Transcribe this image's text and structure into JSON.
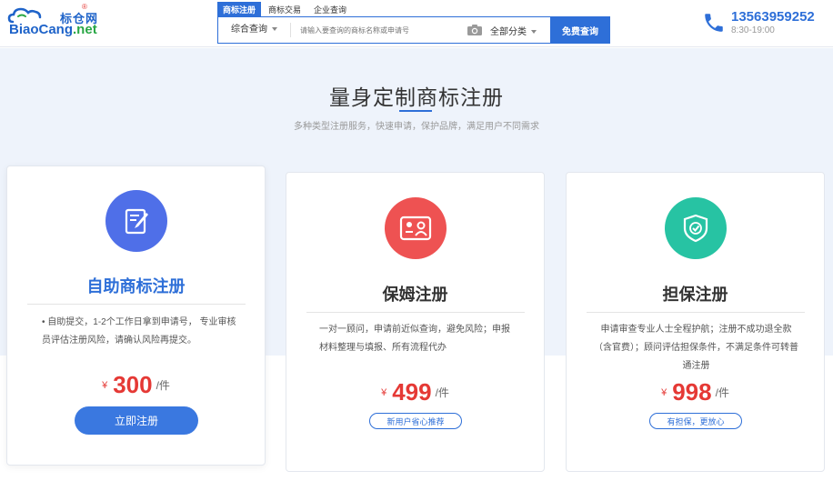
{
  "header": {
    "logo_cn": "标仓网",
    "logo_reg": "®",
    "logo_en_a": "BiaoCang",
    "logo_en_b": ".net",
    "search_tabs": [
      {
        "label": "商标注册",
        "active": true
      },
      {
        "label": "商标交易",
        "active": false
      },
      {
        "label": "企业查询",
        "active": false
      }
    ],
    "search_type": "综合查询",
    "search_placeholder": "请输入要查询的商标名称或申请号",
    "category": "全部分类",
    "search_button": "免费查询",
    "phone": "13563959252",
    "hours": "8:30-19:00"
  },
  "section": {
    "title": "量身定制商标注册",
    "subtitle": "多种类型注册服务，快速申请，保护品牌，满足用户不同需求"
  },
  "cards": [
    {
      "icon": "edit-document-icon",
      "title": "自助商标注册",
      "desc": "• 自助提交，1-2个工作日拿到申请号， 专业审核员评估注册风险，请确认风险再提交。",
      "currency": "¥",
      "price": "300",
      "unit": "/件",
      "cta": "立即注册"
    },
    {
      "icon": "id-card-icon",
      "title": "保姆注册",
      "desc": "一对一顾问，申请前近似查询，避免风险；申报材料整理与填报、所有流程代办",
      "currency": "¥",
      "price": "499",
      "unit": "/件",
      "tag": "新用户省心推荐"
    },
    {
      "icon": "shield-check-icon",
      "title": "担保注册",
      "desc": "申请审查专业人士全程护航；注册不成功退全款（含官费）；顾问评估担保条件，不满足条件可转普通注册",
      "currency": "¥",
      "price": "998",
      "unit": "/件",
      "tag": "有担保，更放心"
    }
  ],
  "colors": {
    "primary": "#2e6fd8",
    "price_red": "#e53935",
    "band_bg": "#eef3fb",
    "icon_blue": "#4f6fe8",
    "icon_red": "#ee5252",
    "icon_green": "#27c3a3"
  }
}
